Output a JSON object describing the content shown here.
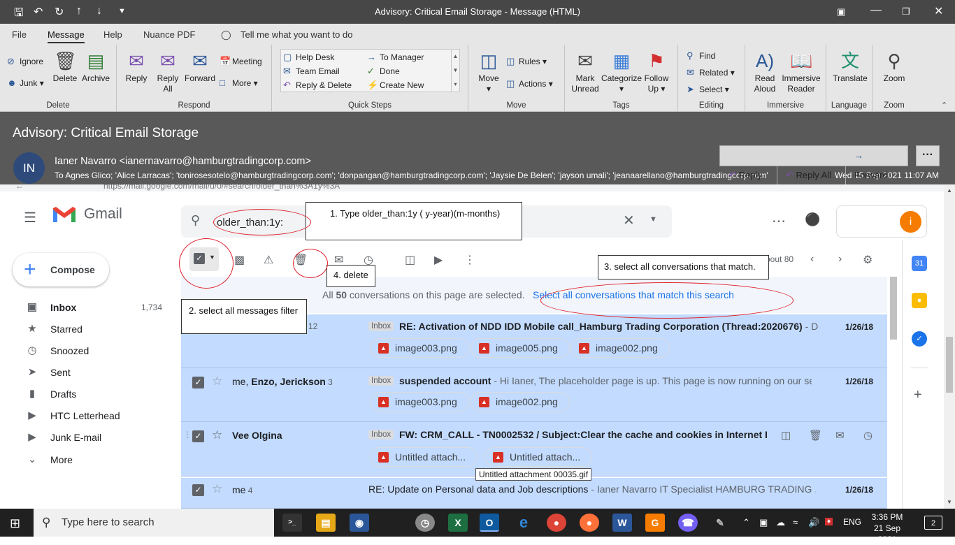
{
  "window": {
    "title": "Advisory: Critical Email Storage  -  Message (HTML)"
  },
  "menu_tabs": [
    "File",
    "Message",
    "Help",
    "Nuance PDF"
  ],
  "tell_me": "Tell me what you want to do",
  "ribbon": {
    "delete_group": {
      "label": "Delete",
      "ignore": "Ignore",
      "junk": "Junk",
      "delete": "Delete",
      "archive": "Archive"
    },
    "respond_group": {
      "label": "Respond",
      "reply": "Reply",
      "reply_all_1": "Reply",
      "reply_all_2": "All",
      "forward": "Forward",
      "meeting": "Meeting",
      "more": "More"
    },
    "quick_steps": {
      "label": "Quick Steps",
      "items": [
        "Help Desk",
        "Team Email",
        "Reply & Delete",
        "To Manager",
        "Done",
        "Create New"
      ]
    },
    "move_group": {
      "label": "Move",
      "move": "Move",
      "rules": "Rules",
      "actions": "Actions"
    },
    "tags_group": {
      "label": "Tags",
      "mark_unread_1": "Mark",
      "mark_unread_2": "Unread",
      "categorize": "Categorize",
      "follow_up_1": "Follow",
      "follow_up_2": "Up"
    },
    "editing_group": {
      "label": "Editing",
      "find": "Find",
      "related": "Related",
      "select": "Select"
    },
    "immersive_group": {
      "label": "Immersive",
      "read_aloud_1": "Read",
      "read_aloud_2": "Aloud",
      "reader_1": "Immersive",
      "reader_2": "Reader"
    },
    "language_group": {
      "label": "Language",
      "translate": "Translate"
    },
    "zoom_group": {
      "label": "Zoom",
      "zoom": "Zoom"
    }
  },
  "message": {
    "subject": "Advisory: Critical Email Storage",
    "avatar_initials": "IN",
    "sender": "Ianer Navarro <ianernavarro@hamburgtradingcorp.com>",
    "to": "To   Agnes Glico; 'Alice Larracas'; 'tonirosesotelo@hamburgtradingcorp.com'; 'donpangan@hamburgtradingcorp.com'; 'Jaysie De Belen'; 'jayson umali'; 'jeanaarellano@hamburgtradingcorp.com'",
    "date": "Wed 15 Sep 2021 11:07 AM",
    "buttons": {
      "reply": "Reply",
      "reply_all": "Reply All",
      "forward": "Forward",
      "more": "···"
    }
  },
  "gmail": {
    "url": "https://mail.google.com/mail/u/0/#search/older_than%3A1y%3A",
    "brand": "Gmail",
    "search_value": "older_than:1y:",
    "compose": "Compose",
    "nav": [
      {
        "label": "Inbox",
        "count": "1,734",
        "icon": "inbox-icon"
      },
      {
        "label": "Starred",
        "count": "",
        "icon": "star-icon"
      },
      {
        "label": "Snoozed",
        "count": "",
        "icon": "clock-icon"
      },
      {
        "label": "Sent",
        "count": "",
        "icon": "send-icon"
      },
      {
        "label": "Drafts",
        "count": "",
        "icon": "draft-icon"
      },
      {
        "label": "HTC Letterhead",
        "count": "",
        "icon": "label-icon"
      },
      {
        "label": "Junk E-mail",
        "count": "",
        "icon": "label-icon"
      },
      {
        "label": "More",
        "count": "",
        "icon": "chevron-down-icon"
      }
    ],
    "pagination": "bout 80",
    "selection_banner": {
      "prefix": "All ",
      "count": "50",
      "suffix": " conversations on this page are selected.",
      "link": "Select all conversations that match this search"
    },
    "rows": [
      {
        "from": "12",
        "badge": "Inbox",
        "subject": "RE: Activation of NDD IDD Mobile call_Hamburg Trading Corporation (Thread:2020676)",
        "snippet": " - De...",
        "date": "1/26/18",
        "attachments": [
          "image003.png",
          "image005.png",
          "image002.png"
        ]
      },
      {
        "from_plain": "me, ",
        "from_bold": "Enzo, Jerickson",
        "from_count": " 3",
        "badge": "Inbox",
        "subject": "suspended account",
        "snippet": " - Hi Ianer, The placeholder page is up. This page is now running on our se...",
        "date": "1/26/18",
        "attachments": [
          "image003.png",
          "image002.png"
        ]
      },
      {
        "from": "Vee Olgina",
        "badge": "Inbox",
        "subject": "FW: CRM_CALL - TN0002532 / Subject:Clear the cache and cookies in Internet Ex...",
        "snippet": "",
        "date": "",
        "attachments": [
          "Untitled attach...",
          "Untitled attach..."
        ]
      },
      {
        "from": "me",
        "from_count": " 4",
        "badge": "",
        "subject": "RE: Update on Personal data and Job descriptions",
        "snippet": " - Ianer Navarro IT Specialist HAMBURG TRADING ...",
        "date": "1/26/18",
        "attachments": []
      }
    ],
    "tooltip": "Untitled attachment 00035.gif",
    "avatar_letter": "i"
  },
  "callouts": {
    "step1": "1.    Type older_than:1y  ( y-year)(m-months)",
    "step2": "2. select all messages filter",
    "step3": "3. select all conversations that match.",
    "step4": "4. delete"
  },
  "taskbar": {
    "search_placeholder": "Type here to search",
    "lang": "ENG",
    "time": "3:36 PM",
    "date": "21 Sep 2021",
    "notifications": "2"
  }
}
